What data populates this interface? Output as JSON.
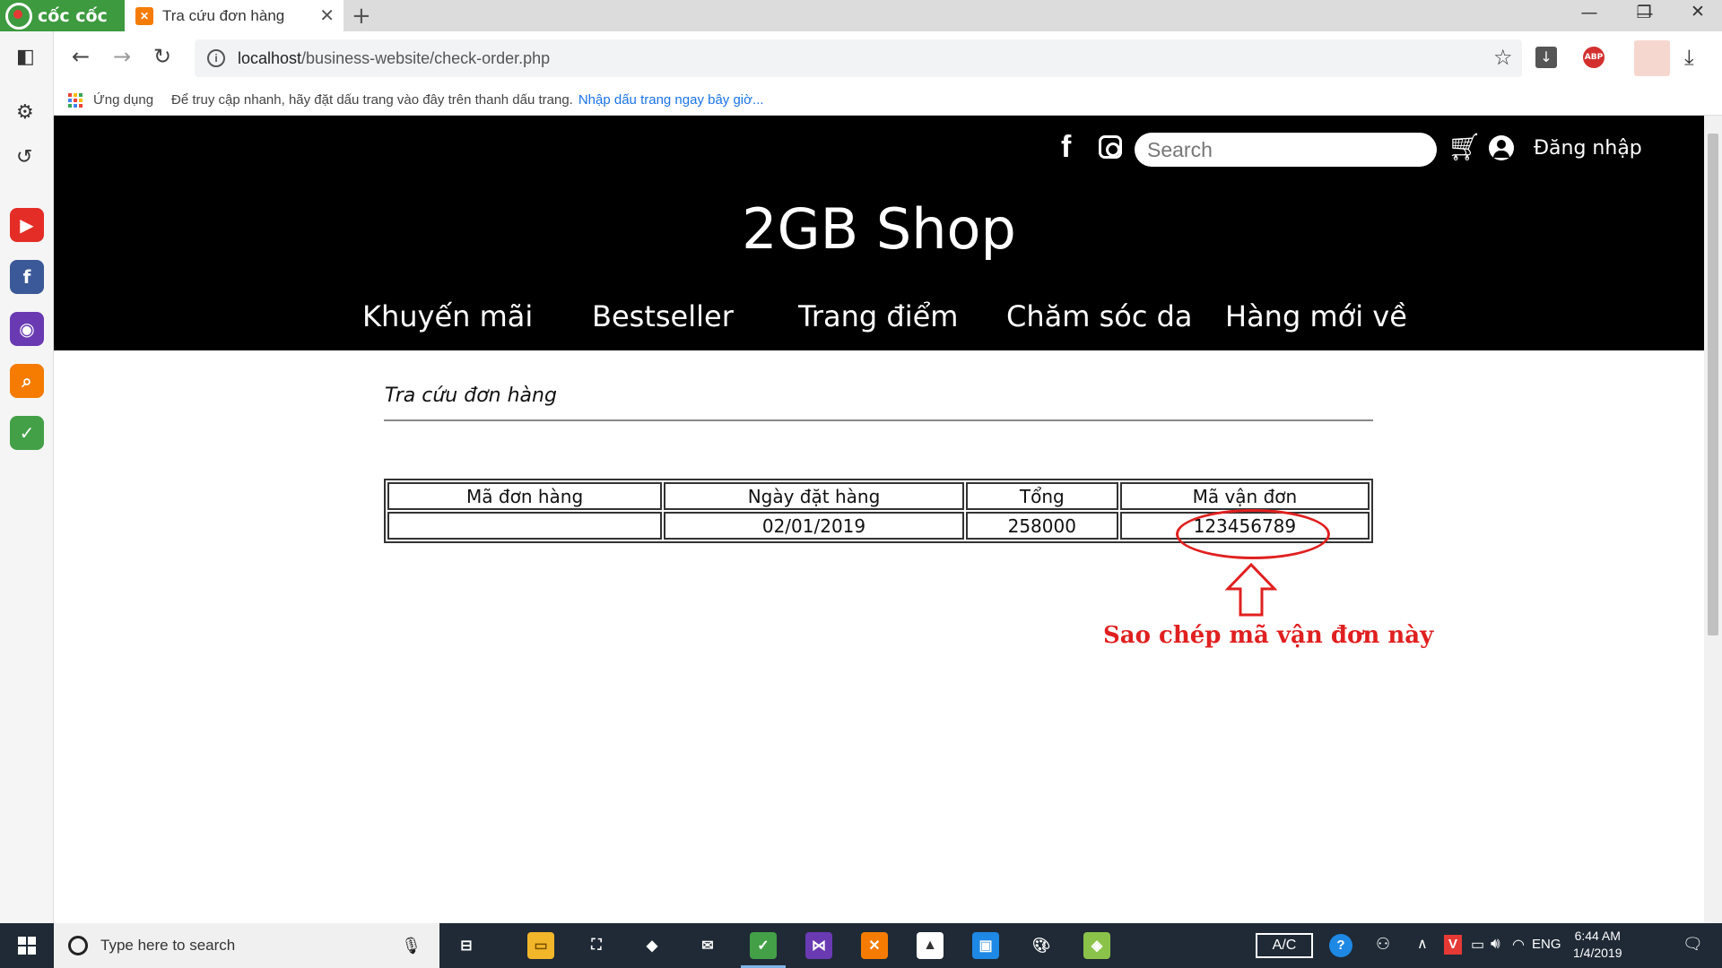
{
  "browser": {
    "brand": "cốc cốc",
    "tab_title": "Tra cứu đơn hàng",
    "url_host": "localhost",
    "url_path": "/business-website/check-order.php",
    "bookmarks_apps_label": "Ứng dụng",
    "bookmarks_hint": "Để truy cập nhanh, hãy đặt dấu trang vào đây trên thanh dấu trang.",
    "bookmarks_import_link": "Nhập dấu trang ngay bây giờ...",
    "adblock_label": "ABP"
  },
  "site": {
    "search_placeholder": "Search",
    "login_label": "Đăng nhập",
    "title": "2GB Shop",
    "menu": [
      "Khuyến mãi",
      "Bestseller",
      "Trang điểm",
      "Chăm sóc da",
      "Hàng mới về"
    ]
  },
  "page": {
    "heading": "Tra cứu đơn hàng",
    "table": {
      "headers": [
        "Mã đơn hàng",
        "Ngày đặt hàng",
        "Tổng",
        "Mã vận đơn"
      ],
      "rows": [
        [
          "",
          "02/01/2019",
          "258000",
          "123456789"
        ]
      ]
    },
    "annotation": "Sao chép mã vận đơn này",
    "annotation_color": "#e02020"
  },
  "taskbar": {
    "search_placeholder": "Type here to search",
    "ac_label": "A/C",
    "language": "ENG",
    "time": "6:44 AM",
    "date": "1/4/2019"
  }
}
